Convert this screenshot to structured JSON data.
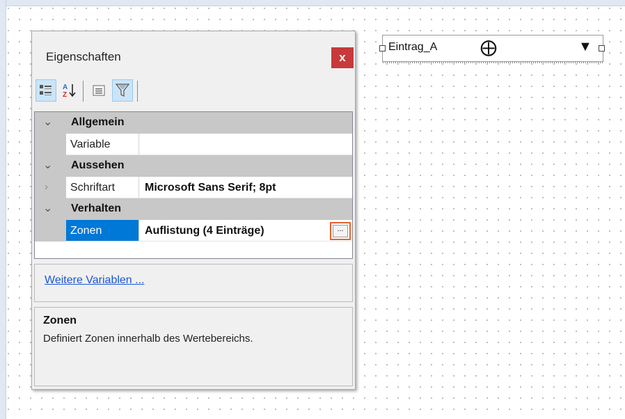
{
  "panel": {
    "title": "Eigenschaften",
    "close_label": "x",
    "toolbar": {
      "icons": [
        "categorized-icon",
        "sort-alpha-icon",
        "property-pages-icon",
        "filter-icon"
      ],
      "sort_label": "AZ"
    },
    "categories": [
      {
        "label": "Allgemein",
        "properties": [
          {
            "name": "Variable",
            "value": ""
          }
        ]
      },
      {
        "label": "Aussehen",
        "properties": [
          {
            "name": "Schriftart",
            "value": "Microsoft Sans Serif; 8pt"
          }
        ]
      },
      {
        "label": "Verhalten",
        "properties": [
          {
            "name": "Zonen",
            "value": "Auflistung (4 Einträge)",
            "selected": true,
            "button": "..."
          }
        ]
      }
    ],
    "link": "Weitere Variablen ...",
    "description": {
      "title": "Zonen",
      "text": "Definiert Zonen innerhalb des Wertebereichs."
    }
  },
  "widget": {
    "label": "Eintrag_A",
    "move_icon": "move-icon",
    "dropdown_icon": "dropdown-arrow-icon"
  },
  "colors": {
    "selected": "#0078d7",
    "category_bg": "#c8c8c8",
    "highlight_border": "#e8612c",
    "close_bg": "#c8393b",
    "link": "#1a56d6"
  }
}
